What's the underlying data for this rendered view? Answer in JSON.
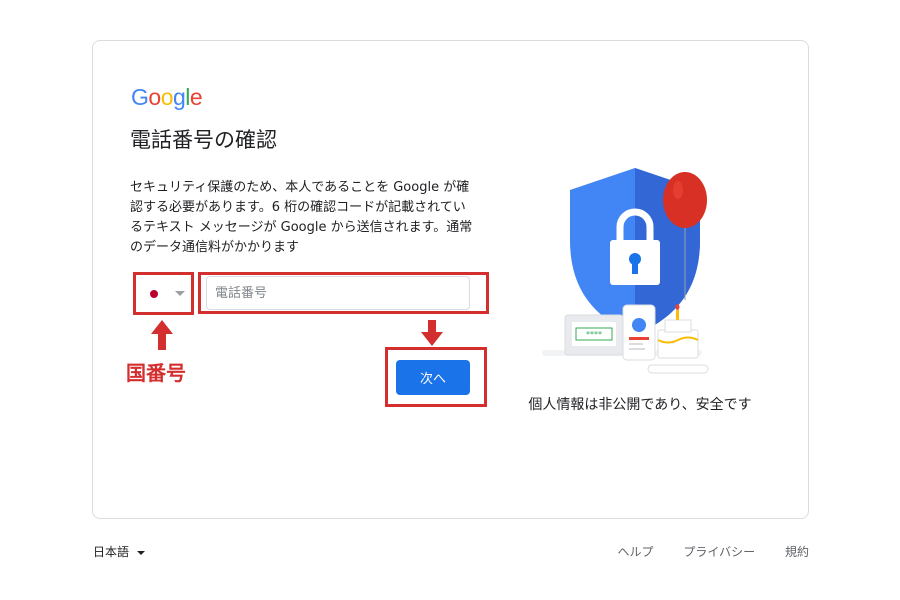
{
  "logo": {
    "letters": [
      {
        "ch": "G",
        "color": "#4285F4"
      },
      {
        "ch": "o",
        "color": "#EA4335"
      },
      {
        "ch": "o",
        "color": "#FBBC05"
      },
      {
        "ch": "g",
        "color": "#4285F4"
      },
      {
        "ch": "l",
        "color": "#34A853"
      },
      {
        "ch": "e",
        "color": "#EA4335"
      }
    ]
  },
  "title": "電話番号の確認",
  "description": "セキュリティ保護のため、本人であることを Google が確認する必要があります。6 桁の確認コードが記載されているテキスト メッセージが Google から送信されます。通常のデータ通信料がかかります",
  "country": {
    "flag": "japan-flag-icon",
    "selected": ""
  },
  "phone": {
    "placeholder": "電話番号",
    "value": ""
  },
  "next_button": "次へ",
  "annotation": {
    "label": "国番号",
    "color": "#d42f2f"
  },
  "illustration": {
    "caption": "個人情報は非公開であり、安全です",
    "password_mask": "****"
  },
  "footer": {
    "language": "日本語",
    "links": [
      "ヘルプ",
      "プライバシー",
      "規約"
    ]
  },
  "colors": {
    "accent": "#1a73e8",
    "annotation": "#d42f2f"
  }
}
